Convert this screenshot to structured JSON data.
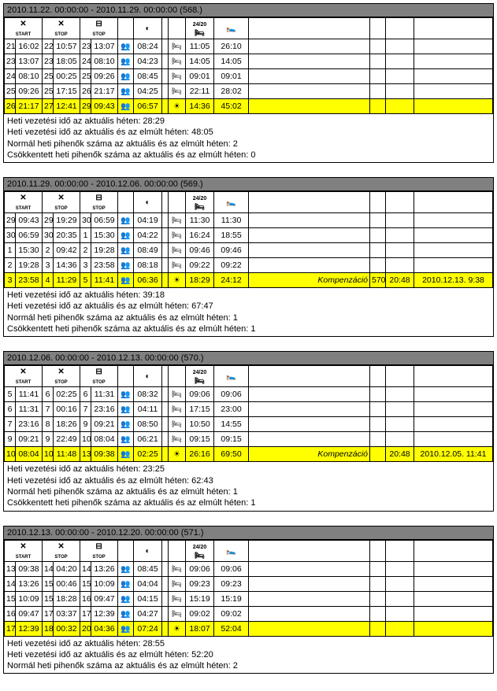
{
  "icons": {
    "start": "✕",
    "stop": "✕",
    "people": "👥",
    "clock": "◐",
    "bed": "🛏",
    "sun": "☀"
  },
  "header_labels": {
    "start": "START",
    "stop": "STOP",
    "h24": "24/20"
  },
  "summary_labels": {
    "l1": "Heti vezetési idő az aktuális héten:",
    "l2": "Heti vezetési idő az aktuális és az elmúlt héten:",
    "l3": "Normál heti pihenők száma az aktuális és az elmúlt héten:",
    "l4": "Csökkentett heti pihenők száma az aktuális és az elmúlt héten:"
  },
  "komp": "Kompenzáció",
  "blocks": [
    {
      "title": "2010.11.22. 00:00:00 - 2010.11.29. 00:00:00 (568.)",
      "rows": [
        {
          "a": "21",
          "at": "16:02",
          "b": "22",
          "bt": "10:57",
          "c": "23",
          "ct": "13:07",
          "d": "08:24",
          "e": "11:05",
          "f": "26:10"
        },
        {
          "a": "23",
          "at": "13:07",
          "b": "23",
          "bt": "18:05",
          "c": "24",
          "ct": "08:10",
          "d": "04:23",
          "e": "14:05",
          "f": "14:05"
        },
        {
          "a": "24",
          "at": "08:10",
          "b": "25",
          "bt": "00:25",
          "c": "25",
          "ct": "09:26",
          "d": "08:45",
          "e": "09:01",
          "f": "09:01"
        },
        {
          "a": "25",
          "at": "09:26",
          "b": "25",
          "bt": "17:15",
          "c": "26",
          "ct": "21:17",
          "d": "04:25",
          "e": "22:11",
          "f": "28:02"
        },
        {
          "hl": true,
          "a": "26",
          "at": "21:17",
          "b": "27",
          "bt": "12:41",
          "c": "29",
          "ct": "09:43",
          "d": "06:57",
          "sun": true,
          "e": "14:36",
          "f": "45:02"
        }
      ],
      "s1": "28:29",
      "s2": "48:05",
      "s3": "2",
      "s4": "0"
    },
    {
      "title": "2010.11.29. 00:00:00 - 2010.12.06. 00:00:00 (569.)",
      "rows": [
        {
          "a": "29",
          "at": "09:43",
          "b": "29",
          "bt": "19:29",
          "c": "30",
          "ct": "06:59",
          "d": "04:19",
          "e": "11:30",
          "f": "11:30"
        },
        {
          "a": "30",
          "at": "06:59",
          "b": "30",
          "bt": "20:35",
          "c": "1",
          "ct": "15:30",
          "d": "04:22",
          "e": "16:24",
          "f": "18:55"
        },
        {
          "a": "1",
          "at": "15:30",
          "b": "2",
          "bt": "09:42",
          "c": "2",
          "ct": "19:28",
          "d": "08:49",
          "e": "09:46",
          "f": "09:46"
        },
        {
          "a": "2",
          "at": "19:28",
          "b": "3",
          "bt": "14:36",
          "c": "3",
          "ct": "23:58",
          "d": "08:18",
          "e": "09:22",
          "f": "09:22"
        },
        {
          "hl": true,
          "a": "3",
          "at": "23:58",
          "b": "4",
          "bt": "11:29",
          "c": "5",
          "ct": "11:41",
          "d": "06:36",
          "sun": true,
          "e": "18:29",
          "f": "24:12",
          "komp": true,
          "k1": "570",
          "k2": "20:48",
          "k3": "2010.12.13. 9:38"
        }
      ],
      "s1": "39:18",
      "s2": "67:47",
      "s3": "1",
      "s4": "1"
    },
    {
      "title": "2010.12.06. 00:00:00 - 2010.12.13. 00:00:00 (570.)",
      "rows": [
        {
          "a": "5",
          "at": "11:41",
          "b": "6",
          "bt": "02:25",
          "c": "6",
          "ct": "11:31",
          "d": "08:32",
          "e": "09:06",
          "f": "09:06"
        },
        {
          "a": "6",
          "at": "11:31",
          "b": "7",
          "bt": "00:16",
          "c": "7",
          "ct": "23:16",
          "d": "04:11",
          "e": "17:15",
          "f": "23:00"
        },
        {
          "a": "7",
          "at": "23:16",
          "b": "8",
          "bt": "18:26",
          "c": "9",
          "ct": "09:21",
          "d": "08:50",
          "e": "10:50",
          "f": "14:55"
        },
        {
          "a": "9",
          "at": "09:21",
          "b": "9",
          "bt": "22:49",
          "c": "10",
          "ct": "08:04",
          "d": "06:21",
          "e": "09:15",
          "f": "09:15"
        },
        {
          "hl": true,
          "a": "10",
          "at": "08:04",
          "b": "10",
          "bt": "11:48",
          "c": "13",
          "ct": "09:38",
          "d": "02:25",
          "sun": true,
          "e": "26:16",
          "f": "69:50",
          "komp": true,
          "k1": "",
          "k2": "20:48",
          "k3": "2010.12.05. 11:41"
        }
      ],
      "s1": "23:25",
      "s2": "62:43",
      "s3": "1",
      "s4": "1"
    },
    {
      "title": "2010.12.13. 00:00:00 - 2010.12.20. 00:00:00 (571.)",
      "rows": [
        {
          "a": "13",
          "at": "09:38",
          "b": "14",
          "bt": "04:20",
          "c": "14",
          "ct": "13:26",
          "d": "08:45",
          "e": "09:06",
          "f": "09:06"
        },
        {
          "a": "14",
          "at": "13:26",
          "b": "15",
          "bt": "00:46",
          "c": "15",
          "ct": "10:09",
          "d": "04:04",
          "e": "09:23",
          "f": "09:23"
        },
        {
          "a": "15",
          "at": "10:09",
          "b": "15",
          "bt": "18:28",
          "c": "16",
          "ct": "09:47",
          "d": "04:15",
          "e": "15:19",
          "f": "15:19"
        },
        {
          "a": "16",
          "at": "09:47",
          "b": "17",
          "bt": "03:37",
          "c": "17",
          "ct": "12:39",
          "d": "04:27",
          "e": "09:02",
          "f": "09:02"
        },
        {
          "hl": true,
          "a": "17",
          "at": "12:39",
          "b": "18",
          "bt": "00:32",
          "c": "20",
          "ct": "04:36",
          "d": "07:24",
          "sun": true,
          "e": "18:07",
          "f": "52:04"
        }
      ],
      "s1": "28:55",
      "s2": "52:20",
      "s3": "2",
      "partial": true
    }
  ]
}
